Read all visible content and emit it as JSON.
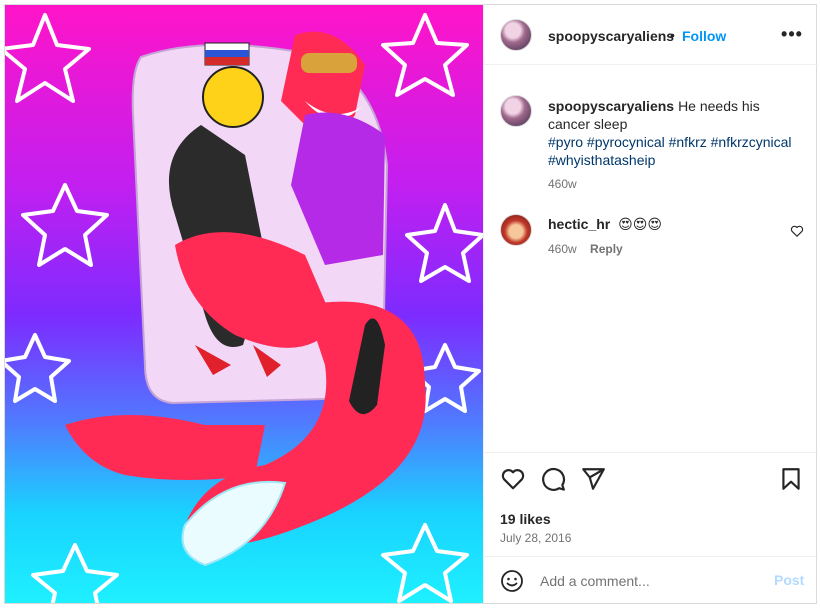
{
  "post": {
    "author": "spoopyscaryaliens",
    "separator": "•",
    "follow_label": "Follow",
    "more_label": "•••",
    "image_alt": "Digital illustration of a red fox character hugging a yellow-faced character on a body pillow, over a pink-to-cyan gradient with white stars"
  },
  "caption": {
    "author": "spoopyscaryaliens",
    "text": "He needs his cancer sleep",
    "hashtags": "#pyro #pyrocynical #nfkrz #nfkrzcynical #whyisthatasheip",
    "age": "460w"
  },
  "comments": [
    {
      "author": "hectic_hr",
      "text": "😍😍😍",
      "age": "460w",
      "reply_label": "Reply"
    }
  ],
  "actions": {
    "like_icon": "heart-icon",
    "comment_icon": "comment-icon",
    "share_icon": "paper-plane-icon",
    "save_icon": "bookmark-icon",
    "likes": "19 likes",
    "date": "July 28, 2016"
  },
  "add_comment": {
    "emoji_icon": "smiley-icon",
    "placeholder": "Add a comment...",
    "post_label": "Post"
  },
  "colors": {
    "link": "#0095f6",
    "hashtag": "#00376b",
    "muted": "#737373",
    "post_disabled": "#b3dbff"
  }
}
